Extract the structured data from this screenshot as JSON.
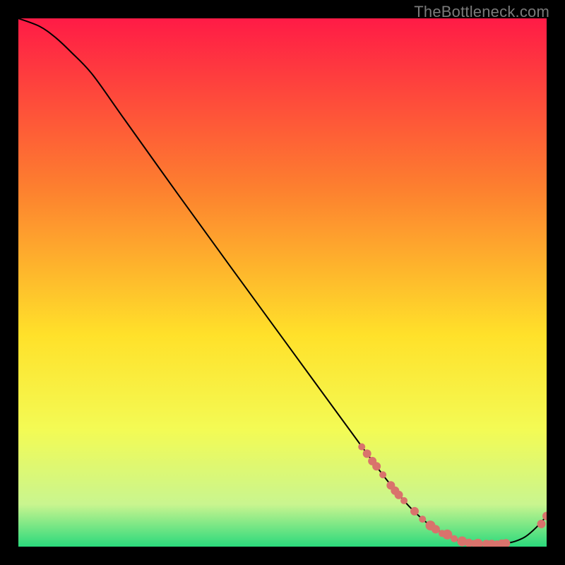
{
  "watermark": "TheBottleneck.com",
  "chart_data": {
    "type": "line",
    "title": "",
    "xlabel": "",
    "ylabel": "",
    "xlim": [
      0,
      100
    ],
    "ylim": [
      0,
      100
    ],
    "grid": false,
    "legend": false,
    "background_gradient": {
      "top": "#ff1b46",
      "mid_upper": "#fd7f2f",
      "mid": "#ffe12a",
      "mid_lower": "#f3fb55",
      "lower": "#c9f58f",
      "bottom": "#2bd97c"
    },
    "series": [
      {
        "name": "curve",
        "type": "line",
        "color": "#000000",
        "x": [
          0,
          4,
          7,
          10,
          14,
          20,
          30,
          40,
          50,
          60,
          66,
          70,
          74,
          78,
          82,
          84,
          86,
          88,
          90,
          92,
          94,
          96,
          98,
          100
        ],
        "y": [
          100.0,
          98.5,
          96.4,
          93.6,
          89.4,
          81.0,
          67.0,
          53.2,
          39.5,
          25.8,
          17.6,
          12.3,
          7.6,
          4.0,
          1.7,
          1.0,
          0.6,
          0.5,
          0.5,
          0.6,
          1.0,
          1.9,
          3.6,
          5.8
        ]
      },
      {
        "name": "markers",
        "type": "scatter",
        "color": "#d9736c",
        "points": [
          {
            "x": 65.0,
            "y": 18.9,
            "r": 5
          },
          {
            "x": 66.0,
            "y": 17.6,
            "r": 6
          },
          {
            "x": 67.0,
            "y": 16.2,
            "r": 6
          },
          {
            "x": 67.8,
            "y": 15.2,
            "r": 6
          },
          {
            "x": 69.0,
            "y": 13.6,
            "r": 5
          },
          {
            "x": 70.5,
            "y": 11.6,
            "r": 6
          },
          {
            "x": 71.3,
            "y": 10.6,
            "r": 6
          },
          {
            "x": 72.0,
            "y": 9.8,
            "r": 6
          },
          {
            "x": 73.0,
            "y": 8.7,
            "r": 5
          },
          {
            "x": 75.0,
            "y": 6.7,
            "r": 6
          },
          {
            "x": 76.5,
            "y": 5.2,
            "r": 5
          },
          {
            "x": 78.0,
            "y": 4.0,
            "r": 7
          },
          {
            "x": 79.0,
            "y": 3.3,
            "r": 6
          },
          {
            "x": 80.2,
            "y": 2.5,
            "r": 5
          },
          {
            "x": 81.2,
            "y": 2.3,
            "r": 7
          },
          {
            "x": 82.5,
            "y": 1.5,
            "r": 5
          },
          {
            "x": 84.0,
            "y": 1.0,
            "r": 7
          },
          {
            "x": 85.3,
            "y": 0.7,
            "r": 6
          },
          {
            "x": 86.3,
            "y": 0.6,
            "r": 5
          },
          {
            "x": 87.0,
            "y": 0.55,
            "r": 7
          },
          {
            "x": 88.6,
            "y": 0.5,
            "r": 6
          },
          {
            "x": 89.6,
            "y": 0.5,
            "r": 6
          },
          {
            "x": 90.6,
            "y": 0.52,
            "r": 5
          },
          {
            "x": 91.5,
            "y": 0.56,
            "r": 6
          },
          {
            "x": 92.3,
            "y": 0.64,
            "r": 6
          },
          {
            "x": 99.0,
            "y": 4.3,
            "r": 6
          },
          {
            "x": 100.0,
            "y": 5.8,
            "r": 6
          }
        ]
      }
    ]
  }
}
